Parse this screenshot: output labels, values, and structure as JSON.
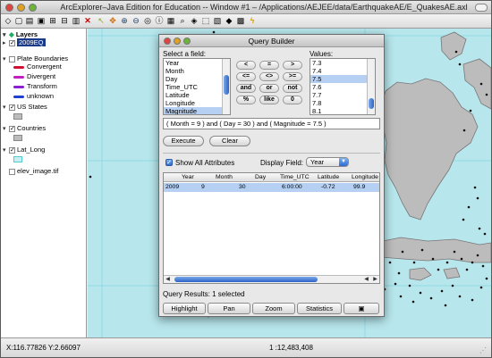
{
  "window": {
    "title": "ArcExplorer–Java Edition for Education -- Window #1 – /Applications/AEJEE/data/EarthquakeAE/E_QuakesAE.axl"
  },
  "toolbar": {
    "icons": [
      "new-map-icon",
      "open-icon",
      "save-icon",
      "print-icon",
      "add-layer-icon",
      "remove-layer-icon",
      "delete-icon",
      "arrow-icon",
      "pan-icon",
      "zoom-in-icon",
      "zoom-out-icon",
      "full-extent-icon",
      "identify-icon",
      "query-icon",
      "find-icon",
      "measure-icon",
      "select-icon",
      "clear-select-icon",
      "hyperlink-icon",
      "buffer-icon",
      "lightning-icon"
    ]
  },
  "sidebar": {
    "header": "Layers",
    "layers": [
      {
        "name": "2009EQ",
        "checked": true,
        "selected": true
      },
      {
        "name": "Plate Boundaries",
        "checked": false,
        "legend": [
          {
            "label": "Convergent",
            "color": "#d01030"
          },
          {
            "label": "Divergent",
            "color": "#c020c0"
          },
          {
            "label": "Transform",
            "color": "#8a20d0"
          },
          {
            "label": "unknown",
            "color": "#2040d0"
          }
        ]
      },
      {
        "name": "US States",
        "checked": true
      },
      {
        "name": "Countries",
        "checked": true
      },
      {
        "name": "Lat_Long",
        "checked": true
      },
      {
        "name": "elev_image.tif",
        "checked": false
      }
    ]
  },
  "query_builder": {
    "title": "Query Builder",
    "field_label": "Select a field:",
    "fields": [
      "Year",
      "Month",
      "Day",
      "Time_UTC",
      "Latitude",
      "Longitude",
      "Magnitude"
    ],
    "selected_field": "Magnitude",
    "values_label": "Values:",
    "values": [
      "7.3",
      "7.4",
      "7.5",
      "7.6",
      "7.7",
      "7.8",
      "8.1"
    ],
    "selected_value": "7.5",
    "operators": [
      "<",
      "=",
      ">",
      "<=",
      "<>",
      ">=",
      "and",
      "or",
      "not",
      "%",
      "like",
      "0"
    ],
    "expression": "( Month  = 9 ) and ( Day  = 30 ) and ( Magnitude  =  7.5 )",
    "execute_label": "Execute",
    "clear_label": "Clear",
    "show_all_label": "Show All Attributes",
    "display_field_label": "Display Field:",
    "display_field_value": "Year",
    "columns": [
      "Year",
      "Month",
      "Day",
      "Time_UTC",
      "Latitude",
      "Longitude"
    ],
    "rows": [
      [
        "2009",
        "9",
        "30",
        "6:00:00",
        "-0.72",
        "99.9"
      ]
    ],
    "results_text": "Query Results: 1 selected",
    "buttons": {
      "highlight": "Highlight",
      "pan": "Pan",
      "zoom": "Zoom",
      "statistics": "Statistics"
    }
  },
  "status": {
    "coords": "X:116.77826 Y:2.66097",
    "scale": "1 :12,483,408"
  }
}
